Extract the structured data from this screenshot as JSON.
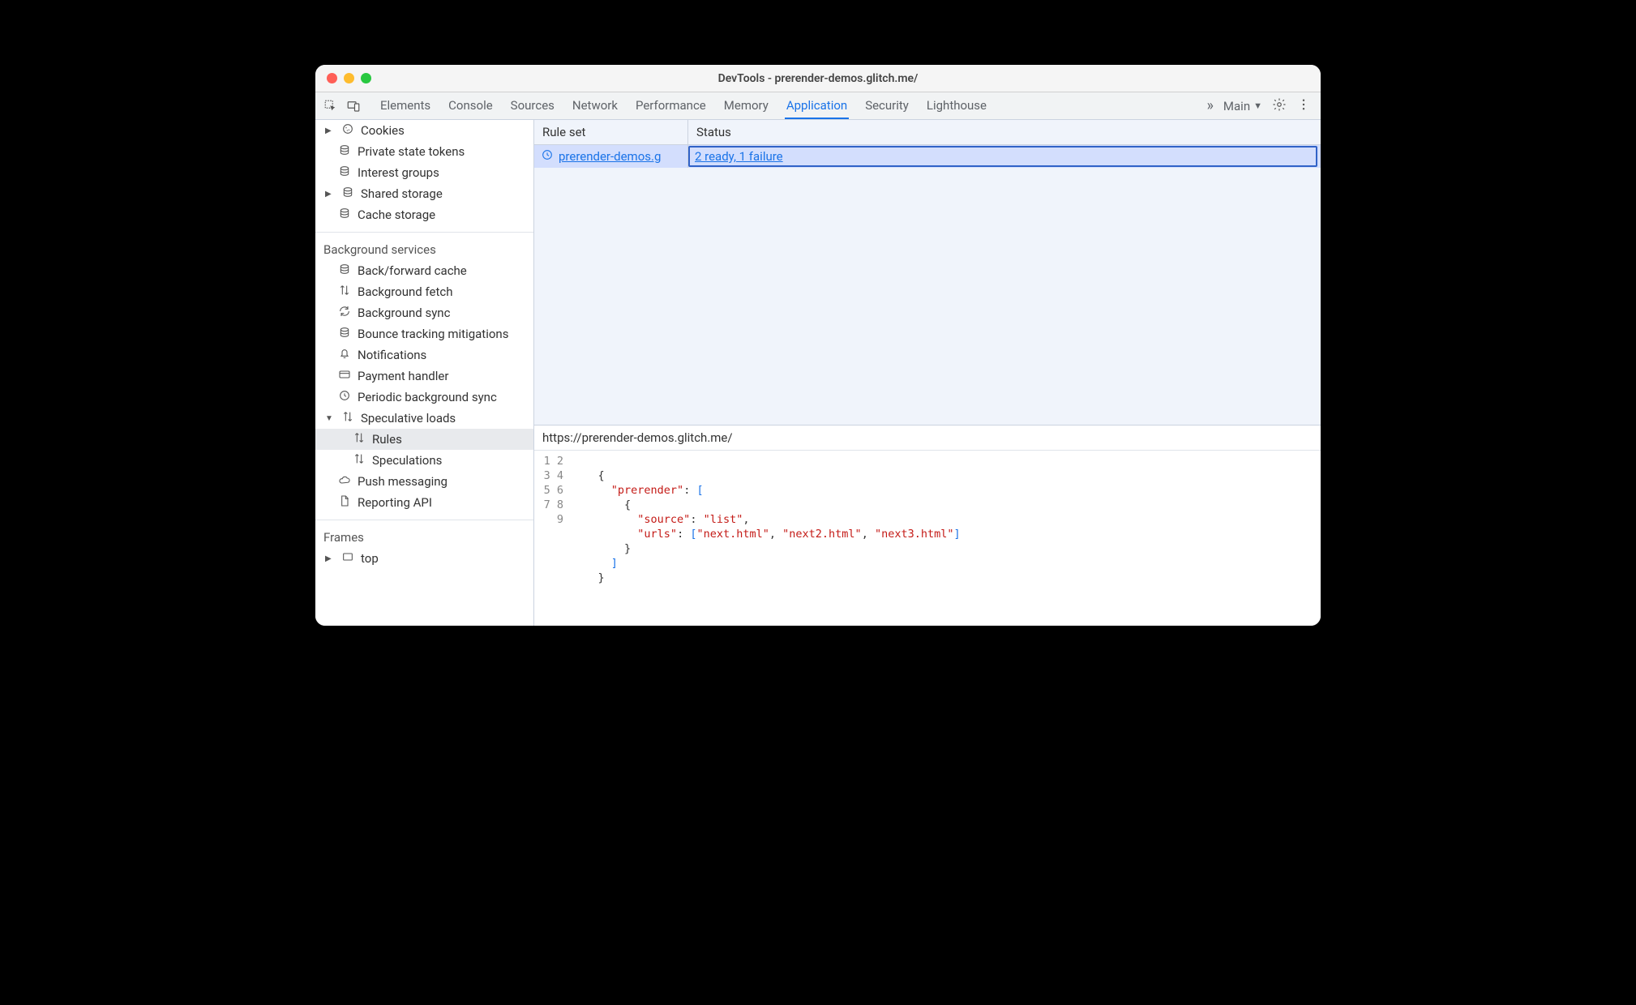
{
  "window": {
    "title": "DevTools - prerender-demos.glitch.me/"
  },
  "toolbar": {
    "tabs": [
      "Elements",
      "Console",
      "Sources",
      "Network",
      "Performance",
      "Memory",
      "Application",
      "Security",
      "Lighthouse"
    ],
    "active_tab": "Application",
    "target_label": "Main"
  },
  "sidebar": {
    "storage_items": [
      {
        "label": "Cookies",
        "icon": "cookie",
        "expandable": true
      },
      {
        "label": "Private state tokens",
        "icon": "db"
      },
      {
        "label": "Interest groups",
        "icon": "db"
      },
      {
        "label": "Shared storage",
        "icon": "db",
        "expandable": true
      },
      {
        "label": "Cache storage",
        "icon": "db"
      }
    ],
    "bg_title": "Background services",
    "bg_items": [
      {
        "label": "Back/forward cache",
        "icon": "db"
      },
      {
        "label": "Background fetch",
        "icon": "updown"
      },
      {
        "label": "Background sync",
        "icon": "sync"
      },
      {
        "label": "Bounce tracking mitigations",
        "icon": "db"
      },
      {
        "label": "Notifications",
        "icon": "bell"
      },
      {
        "label": "Payment handler",
        "icon": "card"
      },
      {
        "label": "Periodic background sync",
        "icon": "clock"
      },
      {
        "label": "Speculative loads",
        "icon": "updown",
        "expandable": true,
        "expanded": true
      },
      {
        "label": "Rules",
        "icon": "updown",
        "depth": 2,
        "selected": true
      },
      {
        "label": "Speculations",
        "icon": "updown",
        "depth": 2
      },
      {
        "label": "Push messaging",
        "icon": "cloud"
      },
      {
        "label": "Reporting API",
        "icon": "doc"
      }
    ],
    "frames_title": "Frames",
    "frames_items": [
      {
        "label": "top",
        "icon": "frame",
        "expandable": true
      }
    ]
  },
  "grid": {
    "columns": [
      "Rule set",
      "Status"
    ],
    "rows": [
      {
        "ruleset": "prerender-demos.g",
        "status": "2 ready, 1 failure",
        "selected": true
      }
    ]
  },
  "detail": {
    "url": "https://prerender-demos.glitch.me/",
    "code": {
      "line_count": 9,
      "tokens": [
        [],
        [
          {
            "t": "brace",
            "v": "{"
          }
        ],
        [
          {
            "t": "indent",
            "v": "  "
          },
          {
            "t": "key",
            "v": "\"prerender\""
          },
          {
            "t": "punc",
            "v": ": "
          },
          {
            "t": "bracket",
            "v": "["
          }
        ],
        [
          {
            "t": "indent",
            "v": "    "
          },
          {
            "t": "brace",
            "v": "{"
          }
        ],
        [
          {
            "t": "indent",
            "v": "      "
          },
          {
            "t": "key",
            "v": "\"source\""
          },
          {
            "t": "punc",
            "v": ": "
          },
          {
            "t": "str",
            "v": "\"list\""
          },
          {
            "t": "punc",
            "v": ","
          }
        ],
        [
          {
            "t": "indent",
            "v": "      "
          },
          {
            "t": "key",
            "v": "\"urls\""
          },
          {
            "t": "punc",
            "v": ": "
          },
          {
            "t": "bracket",
            "v": "["
          },
          {
            "t": "str",
            "v": "\"next.html\""
          },
          {
            "t": "punc",
            "v": ", "
          },
          {
            "t": "str",
            "v": "\"next2.html\""
          },
          {
            "t": "punc",
            "v": ", "
          },
          {
            "t": "str",
            "v": "\"next3.html\""
          },
          {
            "t": "bracket",
            "v": "]"
          }
        ],
        [
          {
            "t": "indent",
            "v": "    "
          },
          {
            "t": "brace",
            "v": "}"
          }
        ],
        [
          {
            "t": "indent",
            "v": "  "
          },
          {
            "t": "bracket",
            "v": "]"
          }
        ],
        [
          {
            "t": "brace",
            "v": "}"
          }
        ]
      ]
    }
  }
}
